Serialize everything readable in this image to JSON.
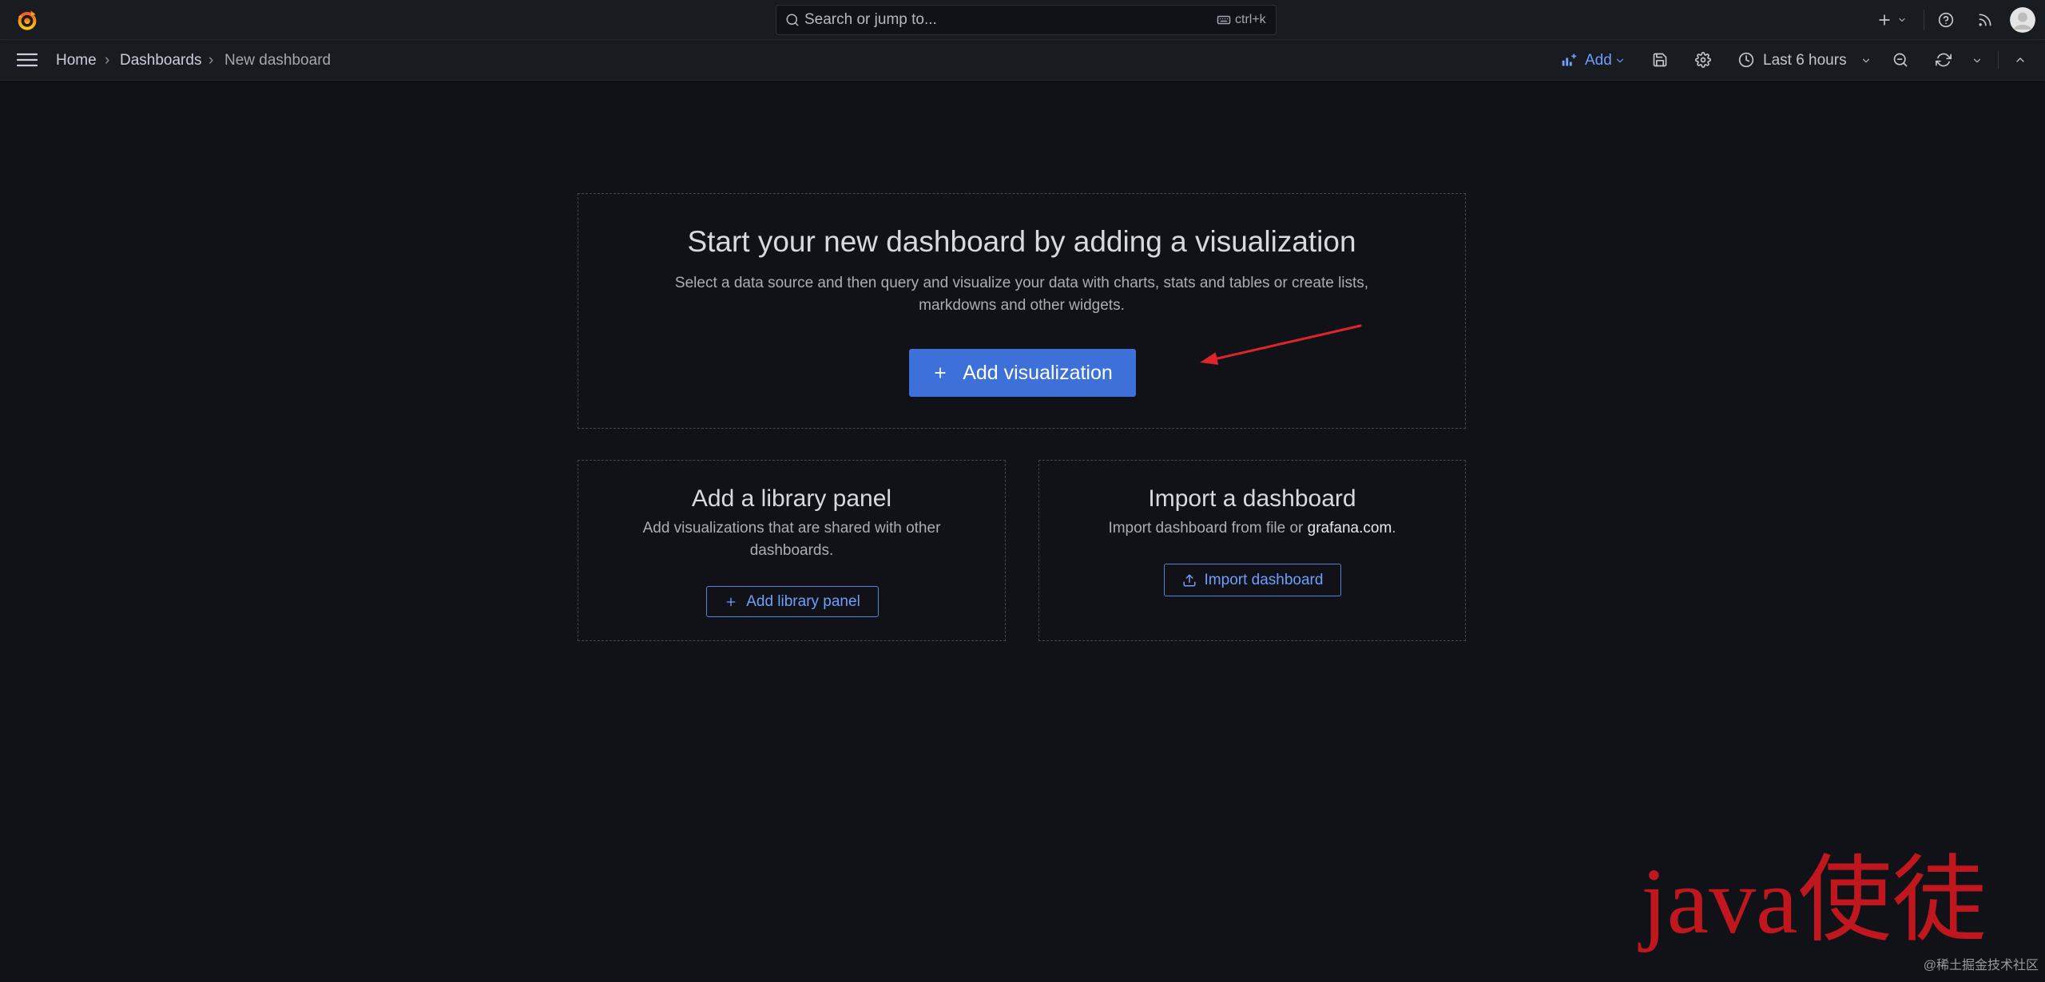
{
  "app": {
    "logo_icon": "grafana-logo"
  },
  "topbar": {
    "search": {
      "placeholder": "Search or jump to...",
      "shortcut": "ctrl+k",
      "icon": "search-icon",
      "shortcut_icon": "keyboard-icon"
    },
    "icons": [
      "plus-icon",
      "chevron-down-icon",
      "help-icon",
      "rss-icon",
      "avatar"
    ]
  },
  "breadcrumb": {
    "separator": "›",
    "items": [
      {
        "label": "Home"
      },
      {
        "label": "Dashboards"
      },
      {
        "label": "New dashboard"
      }
    ]
  },
  "toolbar": {
    "add": {
      "label": "Add",
      "icon": "add-panel-icon"
    },
    "time_picker": {
      "label": "Last 6 hours",
      "icon": "clock-icon"
    },
    "icons": [
      "menu-icon",
      "save-icon",
      "gear-icon",
      "zoom-out-icon",
      "refresh-icon",
      "chevron-up-icon"
    ]
  },
  "empty_state": {
    "title": "Start your new dashboard by adding a visualization",
    "description": "Select a data source and then query and visualize your data with charts, stats and tables or create lists, markdowns and other widgets.",
    "button": {
      "label": "Add visualization",
      "icon": "plus-icon"
    }
  },
  "library_panel": {
    "title": "Add a library panel",
    "description": "Add visualizations that are shared with other dashboards.",
    "button": {
      "label": "Add library panel",
      "icon": "plus-icon"
    }
  },
  "import_dashboard": {
    "title": "Import a dashboard",
    "description_prefix": "Import dashboard from file or ",
    "description_link": "grafana.com",
    "description_suffix": ".",
    "button": {
      "label": "Import dashboard",
      "icon": "upload-icon"
    }
  },
  "watermark": {
    "text": "java使徒",
    "credit": "@稀土掘金技术社区"
  },
  "theme": {
    "canvas": "#111217",
    "panel": "#181b1f",
    "text_primary": "#ccccdc",
    "text_secondary": "#a9adb6",
    "accent": "#3d71d9",
    "link": "#6e9fff",
    "border": "#3a3c43",
    "watermark": "#c0171e",
    "annotation": "#e0242b"
  }
}
